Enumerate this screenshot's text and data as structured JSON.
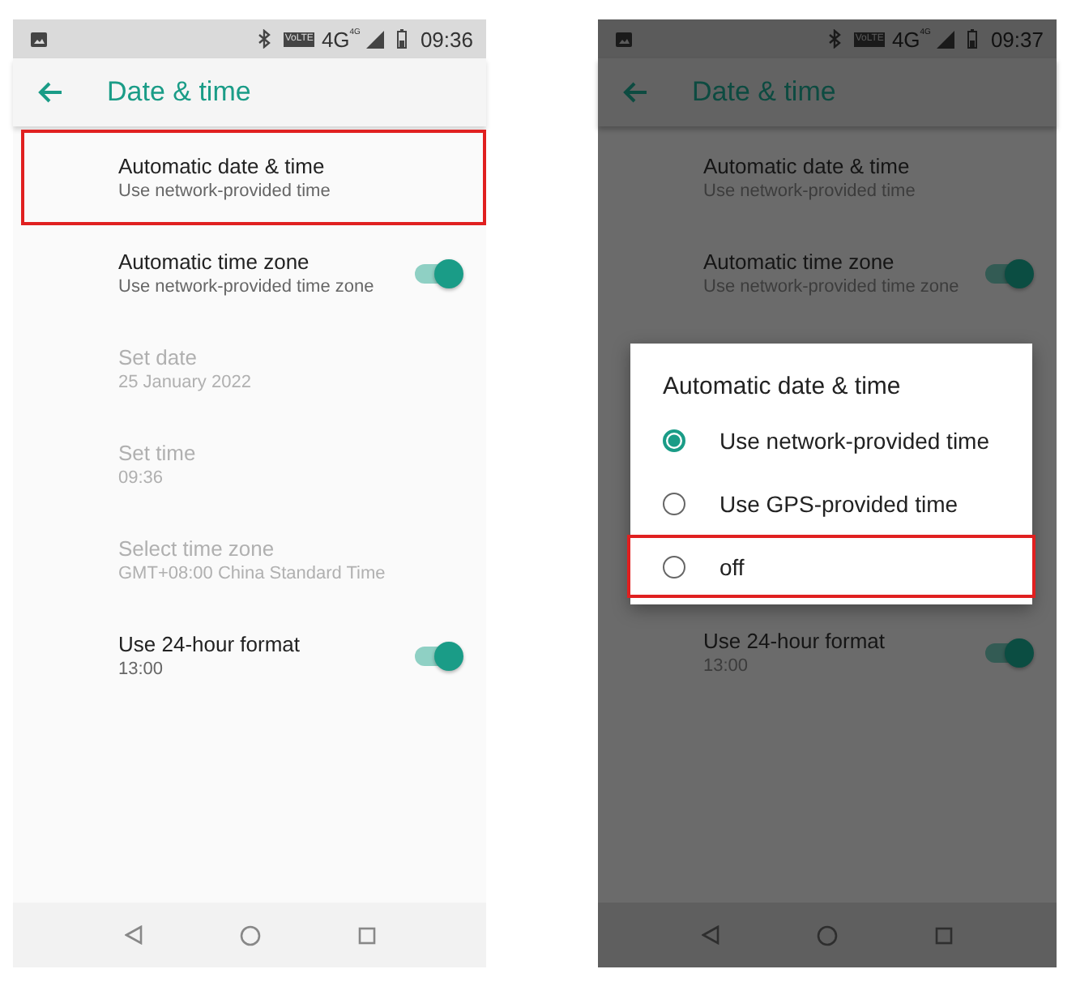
{
  "screens": [
    {
      "dimmed": false,
      "status_bar": {
        "volte": "VoLTE",
        "network": "4G",
        "network_small": "4G",
        "time": "09:36"
      },
      "title": "Date & time",
      "content": [
        {
          "kind": "setting",
          "title": "Automatic date & time",
          "subtitle": "Use network-provided time",
          "disabled": false,
          "highlighted": true
        },
        {
          "kind": "switch",
          "title": "Automatic time zone",
          "subtitle": "Use network-provided time zone",
          "disabled": false,
          "highlighted": false,
          "on": true
        },
        {
          "kind": "setting",
          "title": "Set date",
          "subtitle": "25 January 2022",
          "disabled": true,
          "highlighted": false
        },
        {
          "kind": "setting",
          "title": "Set time",
          "subtitle": "09:36",
          "disabled": true,
          "highlighted": false
        },
        {
          "kind": "setting",
          "title": "Select time zone",
          "subtitle": "GMT+08:00 China Standard Time",
          "disabled": true,
          "highlighted": false
        },
        {
          "kind": "switch",
          "title": "Use 24-hour format",
          "subtitle": "13:00",
          "disabled": false,
          "highlighted": false,
          "on": true
        }
      ]
    },
    {
      "dimmed": true,
      "status_bar": {
        "volte": "VoLTE",
        "network": "4G",
        "network_small": "4G",
        "time": "09:37"
      },
      "title": "Date & time",
      "content": [
        {
          "kind": "setting",
          "title": "Automatic date & time",
          "subtitle": "Use network-provided time",
          "disabled": false,
          "highlighted": false
        },
        {
          "kind": "switch",
          "title": "Automatic time zone",
          "subtitle": "Use network-provided time zone",
          "disabled": false,
          "highlighted": false,
          "on": true
        },
        {
          "kind": "dialog",
          "title": "Automatic date & time",
          "options": [
            {
              "label": "Use network-provided time",
              "selected": true,
              "highlighted": false
            },
            {
              "label": "Use GPS-provided time",
              "selected": false,
              "highlighted": false
            },
            {
              "label": "off",
              "selected": false,
              "highlighted": true
            }
          ]
        },
        {
          "kind": "switch",
          "title": "Use 24-hour format",
          "subtitle": "13:00",
          "disabled": false,
          "highlighted": false,
          "on": true
        }
      ]
    }
  ]
}
